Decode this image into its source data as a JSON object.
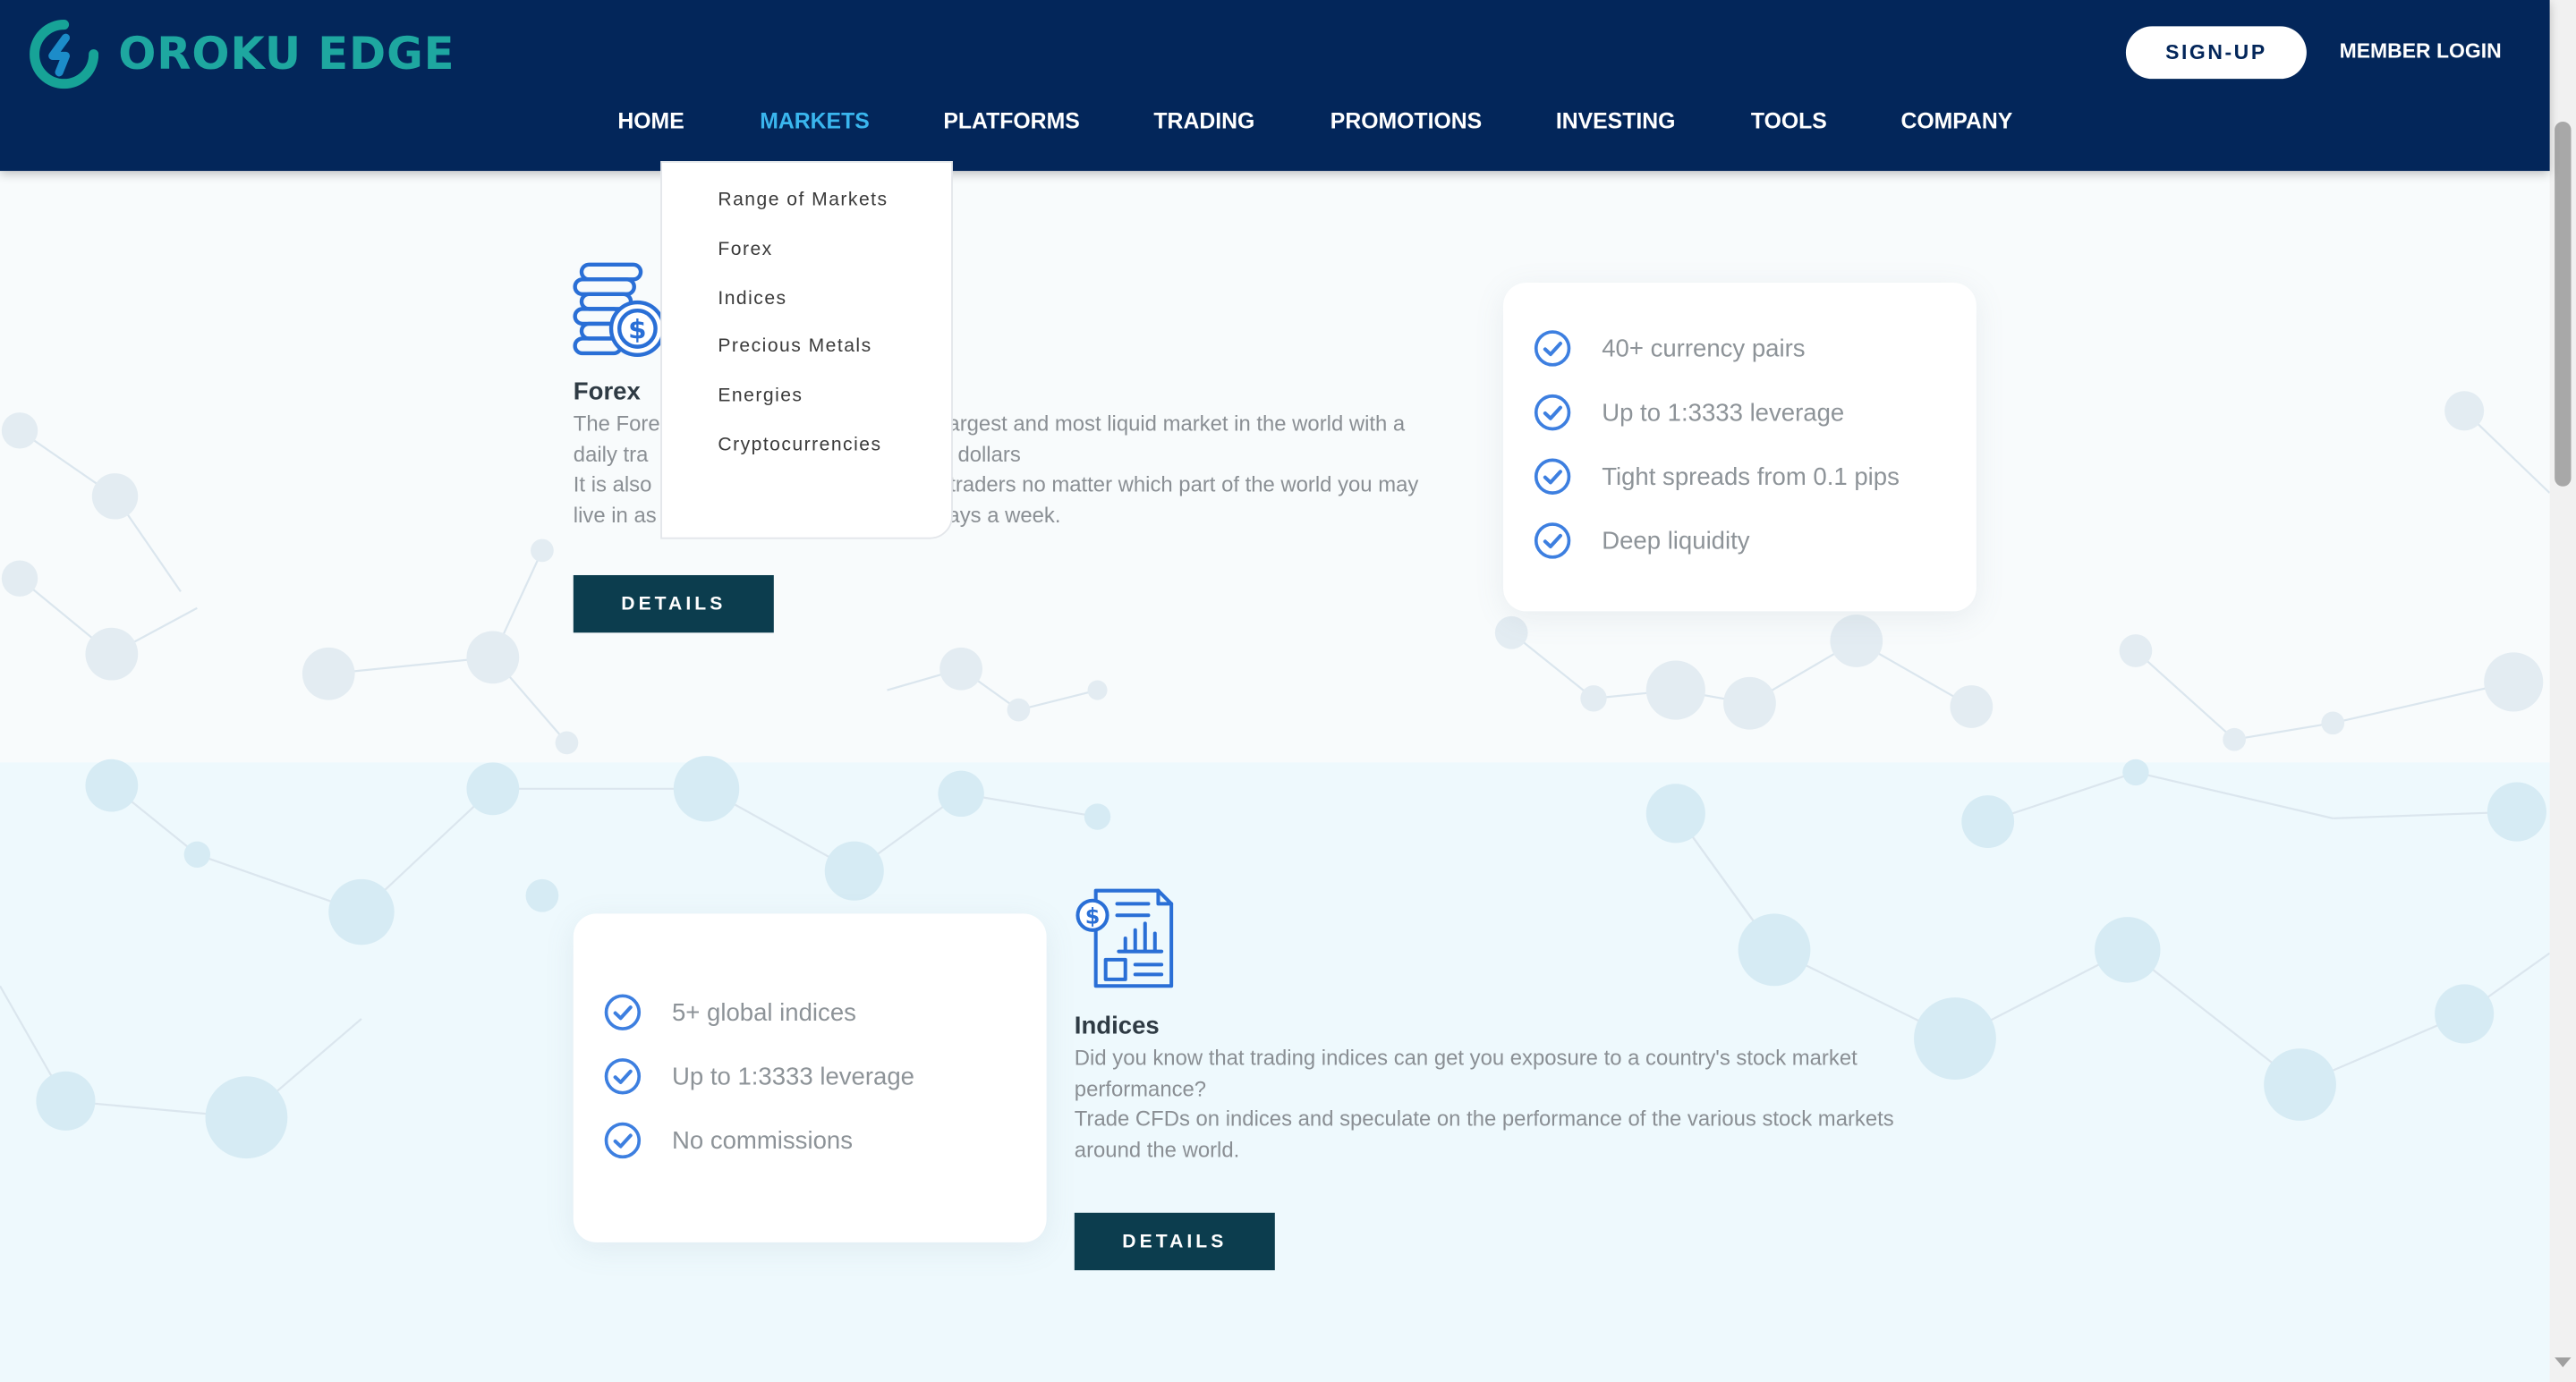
{
  "brand": {
    "name": "OROKU EDGE",
    "logo_color": "#1ea7a0"
  },
  "header": {
    "signup_label": "SIGN-UP",
    "login_label": "MEMBER LOGIN",
    "nav": [
      {
        "label": "HOME"
      },
      {
        "label": "MARKETS",
        "active": true
      },
      {
        "label": "PLATFORMS"
      },
      {
        "label": "TRADING"
      },
      {
        "label": "PROMOTIONS"
      },
      {
        "label": "INVESTING"
      },
      {
        "label": "TOOLS"
      },
      {
        "label": "COMPANY"
      }
    ]
  },
  "dropdown": {
    "items": [
      "Range of Markets",
      "Forex",
      "Indices",
      "Precious Metals",
      "Energies",
      "Cryptocurrencies"
    ]
  },
  "forex": {
    "title": "Forex",
    "desc_lines": [
      "The Fore",
      "argest and most liquid market in the world with a",
      "daily tra",
      "dollars",
      "It is also",
      "traders no matter which part of the world you may",
      "live in as",
      "ays a week."
    ],
    "details_label": "DETAILS",
    "features": [
      "40+ currency pairs",
      "Up to 1:3333 leverage",
      "Tight spreads from 0.1 pips",
      "Deep liquidity"
    ]
  },
  "indices": {
    "title": "Indices",
    "desc_lines": [
      "Did you know that trading indices can get you exposure to a country's stock market",
      "performance?",
      "Trade CFDs on indices and speculate on the performance of the various stock markets",
      "around the world."
    ],
    "details_label": "DETAILS",
    "features": [
      "5+ global indices",
      "Up to 1:3333 leverage",
      "No commissions"
    ]
  },
  "colors": {
    "header_bg": "#03265a",
    "nav_active": "#3ab6ee",
    "button_bg": "#0c3d4e",
    "check_blue": "#3d7fe0",
    "icon_blue": "#2a6fd6"
  }
}
